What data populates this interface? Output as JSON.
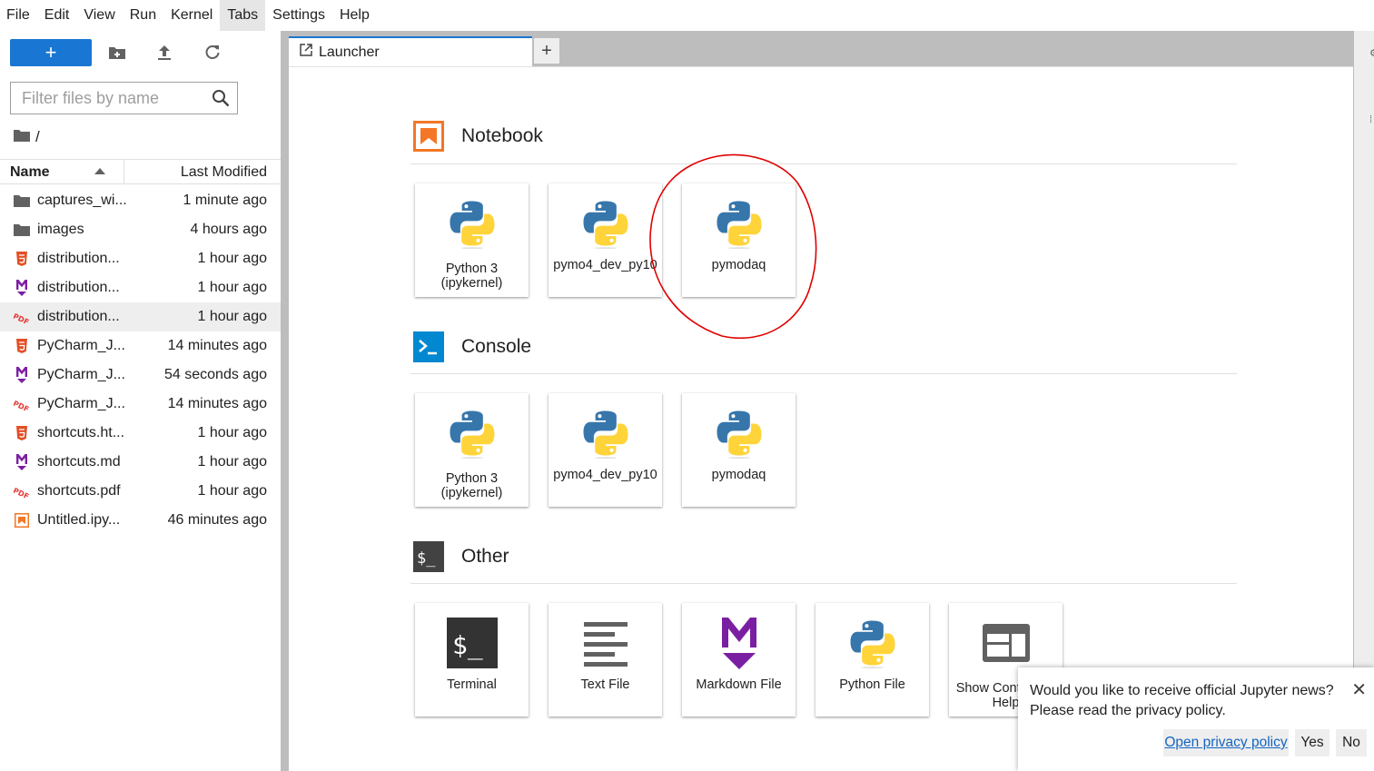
{
  "menu": [
    "File",
    "Edit",
    "View",
    "Run",
    "Kernel",
    "Tabs",
    "Settings",
    "Help"
  ],
  "toolbar": {
    "new_label": "+"
  },
  "filter": {
    "placeholder": "Filter files by name"
  },
  "breadcrumb": {
    "path": "/"
  },
  "file_list": {
    "name_header": "Name",
    "modified_header": "Last Modified",
    "rows": [
      {
        "name": "captures_wi...",
        "modified": "1 minute ago",
        "icon": "folder-icon"
      },
      {
        "name": "images",
        "modified": "4 hours ago",
        "icon": "folder-icon"
      },
      {
        "name": "distribution...",
        "modified": "1 hour ago",
        "icon": "html-file-icon"
      },
      {
        "name": "distribution...",
        "modified": "1 hour ago",
        "icon": "markdown-file-icon"
      },
      {
        "name": "distribution...",
        "modified": "1 hour ago",
        "icon": "pdf-file-icon"
      },
      {
        "name": "PyCharm_J...",
        "modified": "14 minutes ago",
        "icon": "html-file-icon"
      },
      {
        "name": "PyCharm_J...",
        "modified": "54 seconds ago",
        "icon": "markdown-file-icon"
      },
      {
        "name": "PyCharm_J...",
        "modified": "14 minutes ago",
        "icon": "pdf-file-icon"
      },
      {
        "name": "shortcuts.ht...",
        "modified": "1 hour ago",
        "icon": "html-file-icon"
      },
      {
        "name": "shortcuts.md",
        "modified": "1 hour ago",
        "icon": "markdown-file-icon"
      },
      {
        "name": "shortcuts.pdf",
        "modified": "1 hour ago",
        "icon": "pdf-file-icon"
      },
      {
        "name": "Untitled.ipy...",
        "modified": "46 minutes ago",
        "icon": "notebook-file-icon"
      }
    ]
  },
  "tab": {
    "label": "Launcher",
    "add_label": "+"
  },
  "launcher": {
    "notebook": {
      "title": "Notebook",
      "cards": [
        {
          "line1": "Python 3",
          "line2": "(ipykernel)"
        },
        {
          "line1": "pymo4_dev_py10",
          "line2": ""
        },
        {
          "line1": "pymodaq",
          "line2": ""
        }
      ]
    },
    "console": {
      "title": "Console",
      "cards": [
        {
          "line1": "Python 3",
          "line2": "(ipykernel)"
        },
        {
          "line1": "pymo4_dev_py10",
          "line2": ""
        },
        {
          "line1": "pymodaq",
          "line2": ""
        }
      ]
    },
    "other": {
      "title": "Other",
      "cards": [
        {
          "line1": "Terminal",
          "line2": ""
        },
        {
          "line1": "Text File",
          "line2": ""
        },
        {
          "line1": "Markdown File",
          "line2": ""
        },
        {
          "line1": "Python File",
          "line2": ""
        },
        {
          "line1": "Show Contextual",
          "line2": "Help"
        }
      ]
    }
  },
  "notification": {
    "message": "Would you like to receive official Jupyter news? Please read the privacy policy.",
    "close_label": "✕",
    "link_label": "Open privacy policy",
    "yes_label": "Yes",
    "no_label": "No"
  },
  "colors": {
    "accent": "#1976d2",
    "notebook_orange": "#f37726",
    "console_blue": "#0288d1",
    "markdown_purple": "#7b1fa2",
    "annotation_red": "#e00000"
  }
}
